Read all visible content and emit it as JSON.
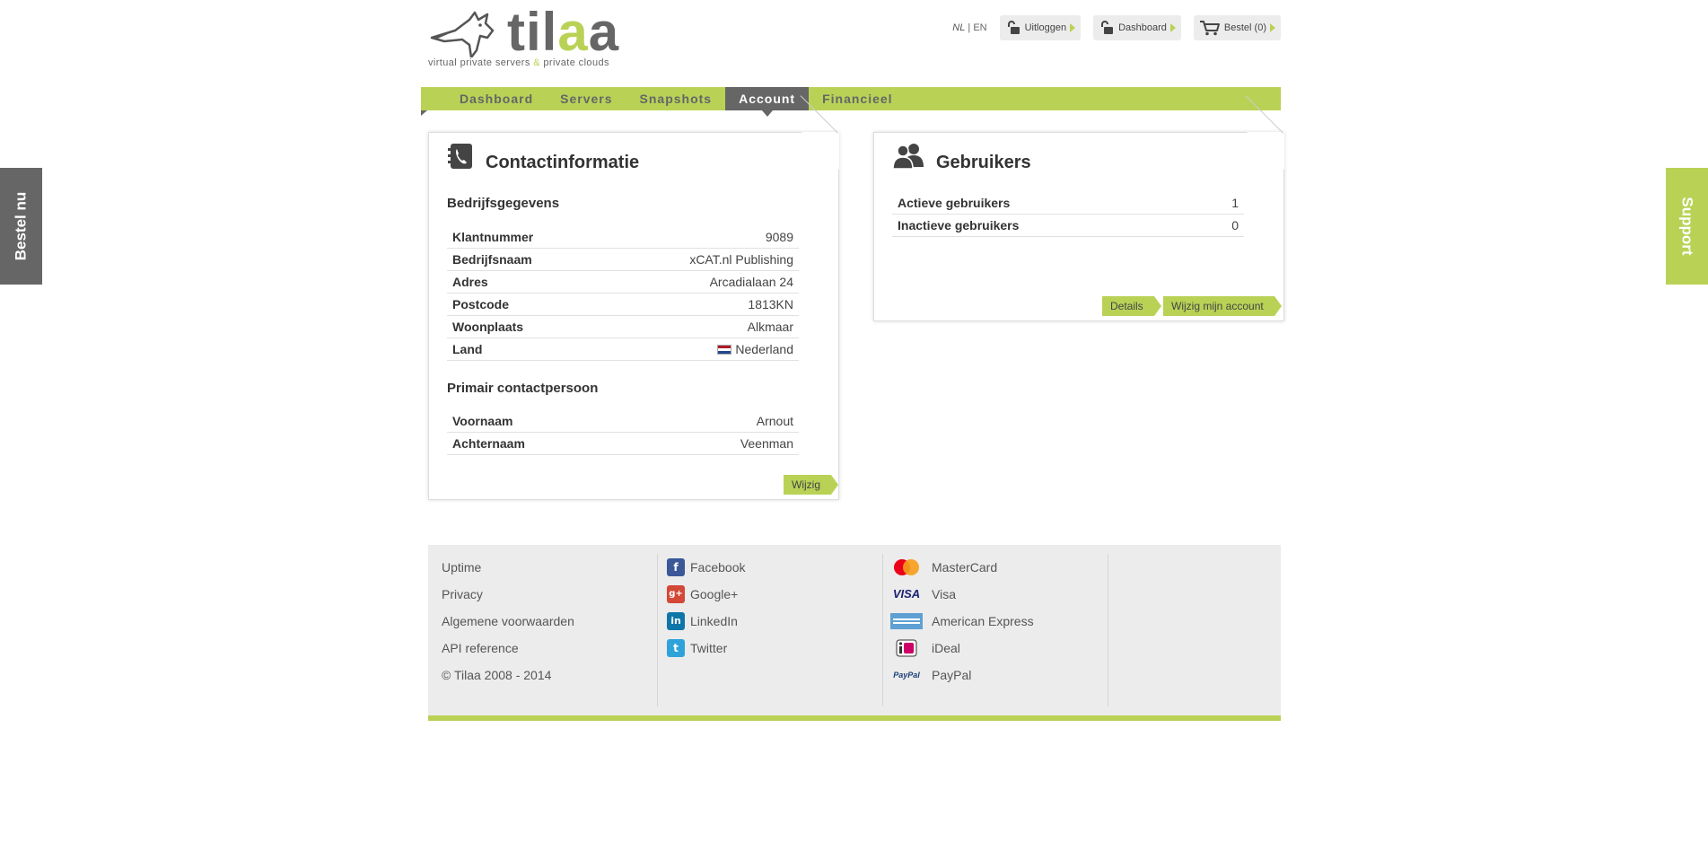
{
  "side_tabs": {
    "left_label": "Bestel nu",
    "right_label": "Support"
  },
  "brand": {
    "name_start": "til",
    "name_highlight": "a",
    "name_end": "a",
    "tagline_before": "virtual private servers ",
    "tagline_amp": "&",
    "tagline_after": " private clouds"
  },
  "topbar": {
    "lang_current": "NL",
    "lang_sep": "|",
    "lang_other": "EN",
    "logout_label": "Uitloggen",
    "dashboard_label": "Dashboard",
    "order_label": "Bestel (0)"
  },
  "nav": {
    "items": [
      {
        "label": "Dashboard"
      },
      {
        "label": "Servers"
      },
      {
        "label": "Snapshots"
      },
      {
        "label": "Account",
        "active": true
      },
      {
        "label": "Financieel"
      }
    ]
  },
  "contact": {
    "title": "Contactinformatie",
    "company_section": "Bedrijfsgegevens",
    "company_rows": [
      {
        "k": "Klantnummer",
        "v": "9089"
      },
      {
        "k": "Bedrijfsnaam",
        "v": "xCAT.nl Publishing"
      },
      {
        "k": "Adres",
        "v": "Arcadialaan 24"
      },
      {
        "k": "Postcode",
        "v": "1813KN"
      },
      {
        "k": "Woonplaats",
        "v": "Alkmaar"
      },
      {
        "k": "Land",
        "v": "Nederland"
      }
    ],
    "person_section": "Primair contactpersoon",
    "person_rows": [
      {
        "k": "Voornaam",
        "v": "Arnout"
      },
      {
        "k": "Achternaam",
        "v": "Veenman"
      }
    ],
    "edit_label": "Wijzig"
  },
  "users": {
    "title": "Gebruikers",
    "rows": [
      {
        "k": "Actieve gebruikers",
        "v": "1"
      },
      {
        "k": "Inactieve gebruikers",
        "v": "0"
      }
    ],
    "details_label": "Details",
    "edit_account_label": "Wijzig mijn account"
  },
  "footer": {
    "links": [
      "Uptime",
      "Privacy",
      "Algemene voorwaarden",
      "API reference",
      "© Tilaa 2008 - 2014"
    ],
    "social": [
      {
        "label": "Facebook",
        "icon": "facebook-icon"
      },
      {
        "label": "Google+",
        "icon": "google-plus-icon"
      },
      {
        "label": "LinkedIn",
        "icon": "linkedin-icon"
      },
      {
        "label": "Twitter",
        "icon": "twitter-icon"
      }
    ],
    "payments": [
      {
        "label": "MasterCard",
        "icon": "mastercard-icon"
      },
      {
        "label": "Visa",
        "icon": "visa-icon"
      },
      {
        "label": "American Express",
        "icon": "amex-icon"
      },
      {
        "label": "iDeal",
        "icon": "ideal-icon"
      },
      {
        "label": "PayPal",
        "icon": "paypal-icon"
      }
    ]
  },
  "colors": {
    "accent": "#b9d256",
    "dark": "#666666",
    "footer_bg": "#ececec"
  }
}
